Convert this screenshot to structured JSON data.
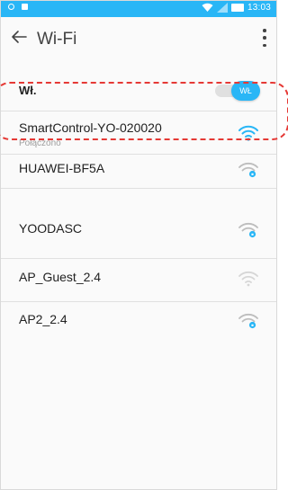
{
  "status_bar": {
    "time": "13:03"
  },
  "app_bar": {
    "title": "Wi-Fi"
  },
  "wifi_toggle": {
    "label": "Wł.",
    "thumb_label": "WŁ"
  },
  "networks": [
    {
      "name": "SmartControl-YO-020020",
      "status": "Połączono",
      "connected": true,
      "locked": false,
      "strength": 1.0
    },
    {
      "name": "HUAWEI-BF5A",
      "status": "",
      "connected": false,
      "locked": true,
      "strength": 0.5
    },
    {
      "name": "YOODASC",
      "status": "",
      "connected": false,
      "locked": true,
      "strength": 0.5
    },
    {
      "name": "AP_Guest_2.4",
      "status": "",
      "connected": false,
      "locked": false,
      "strength": 0.5
    },
    {
      "name": "AP2_2.4",
      "status": "",
      "connected": false,
      "locked": true,
      "strength": 0.5
    }
  ],
  "colors": {
    "accent": "#29b6f6",
    "highlight": "#e53935",
    "icon_inactive": "#bdbdbd"
  }
}
